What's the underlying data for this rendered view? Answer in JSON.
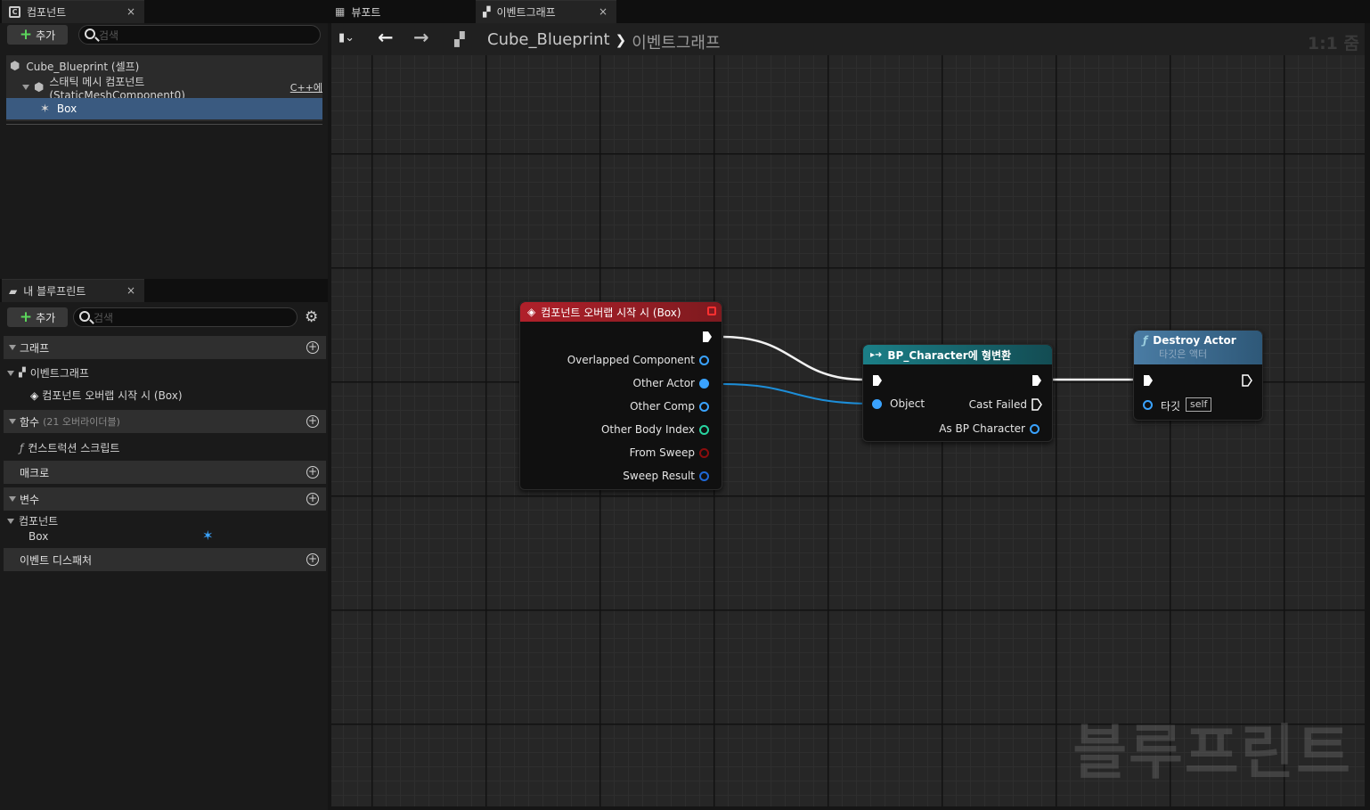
{
  "components_panel": {
    "tab_label": "컴포넌트",
    "close": "×",
    "add_label": "추가",
    "search_placeholder": "검색",
    "tree": [
      {
        "label": "Cube_Blueprint (셀프)"
      },
      {
        "label": "스태틱 메시 컴포넌트 (StaticMeshComponent0)",
        "badge": "C++에"
      },
      {
        "label": "Box"
      }
    ]
  },
  "my_blueprint_panel": {
    "tab_label": "내 블루프린트",
    "close": "×",
    "add_label": "추가",
    "search_placeholder": "검색",
    "categories": {
      "graph": "그래프",
      "event_graph": "이벤트그래프",
      "event_item": "컴포넌트 오버랩 시작 시 (Box)",
      "functions": "함수",
      "functions_count": "(21 오버라이더블)",
      "construction_script": "컨스트럭션 스크립트",
      "macros": "매크로",
      "variables": "변수",
      "components": "컴포넌트",
      "box": "Box",
      "event_dispatchers": "이벤트 디스패처"
    }
  },
  "doc_tabs": [
    {
      "label": "뷰포트"
    },
    {
      "label": "이벤트그래프",
      "close": "×"
    }
  ],
  "toolbar": {
    "breadcrumb_root": "Cube_Blueprint",
    "breadcrumb_sep": "❯",
    "breadcrumb_current": "이벤트그래프",
    "zoom": "1:1 줌"
  },
  "nodes": {
    "overlap_event": {
      "title": "컴포넌트 오버랩 시작 시 (Box)",
      "color": "#a3222a",
      "pins": [
        "Overlapped Component",
        "Other Actor",
        "Other Comp",
        "Other Body Index",
        "From Sweep",
        "Sweep Result"
      ]
    },
    "cast": {
      "title": "BP_Character에 형변환",
      "color": "#1e6e76",
      "input": "Object",
      "fail": "Cast Failed",
      "output": "As BP Character"
    },
    "destroy": {
      "title": "Destroy Actor",
      "subtitle": "타깃은 액터",
      "color": "#3c6a90",
      "target_label": "타깃",
      "target_value": "self"
    }
  },
  "watermark": "블루프린트",
  "colors": {
    "object_pin": "#3aa3ff",
    "int_pin": "#28d4a0",
    "bool_pin": "#8a0d0d",
    "struct_pin": "#1f68d6"
  }
}
